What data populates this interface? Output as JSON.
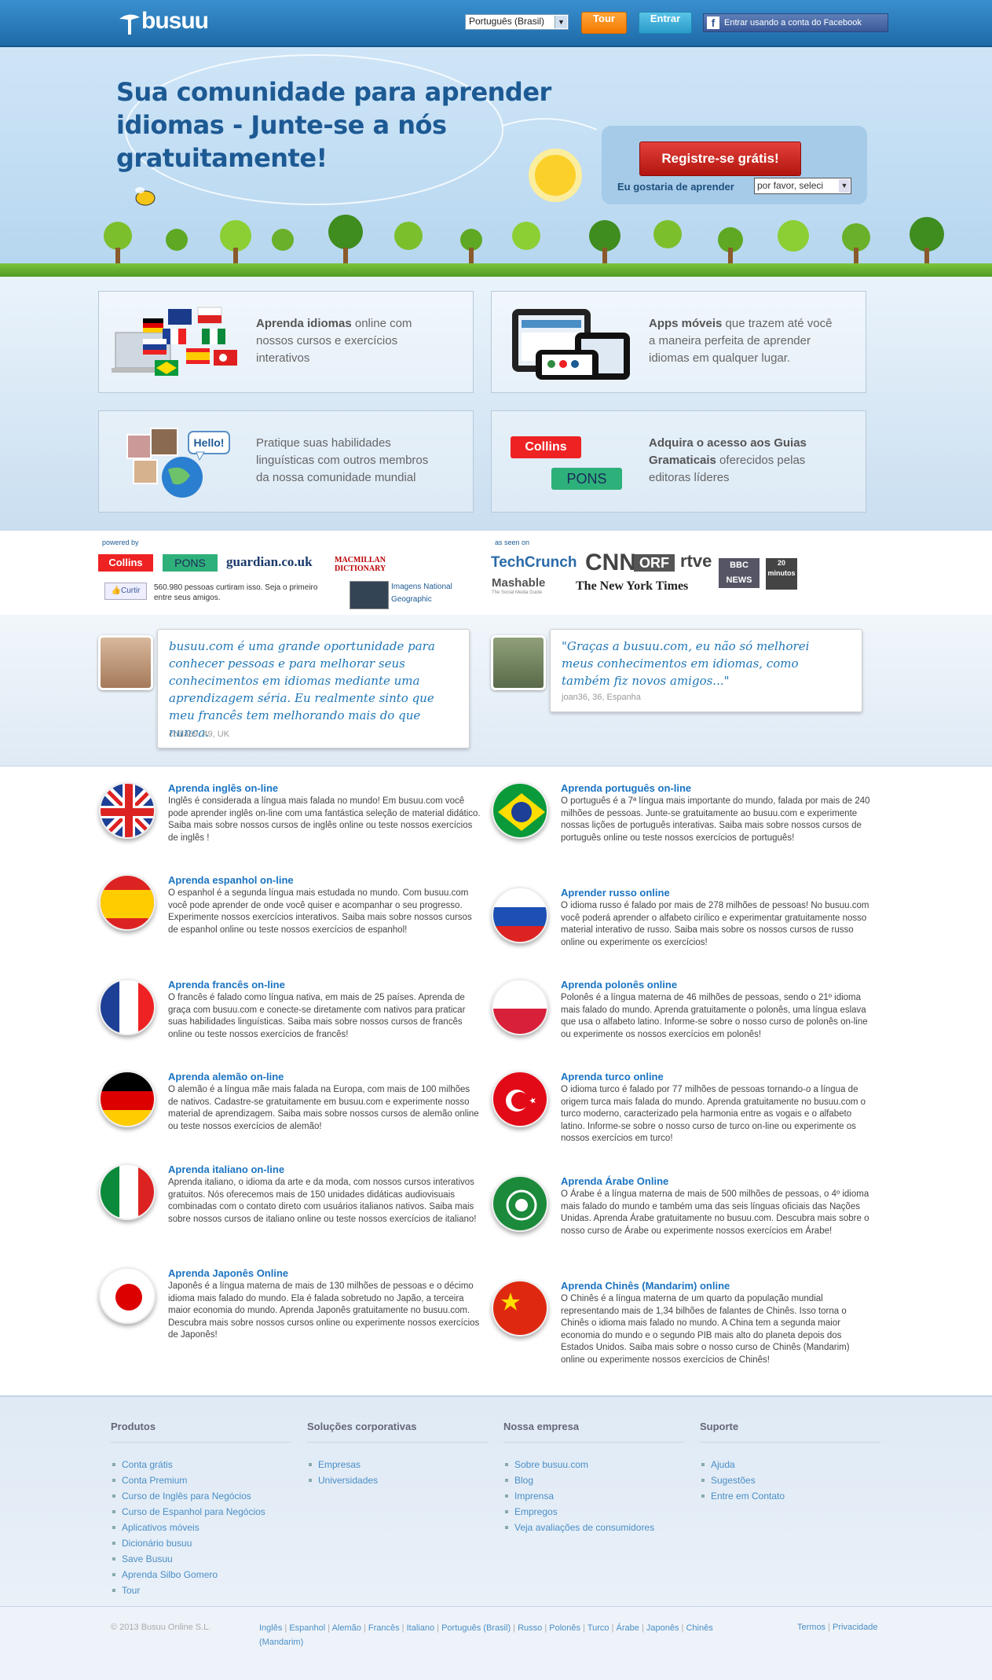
{
  "header": {
    "logo_text": "busuu",
    "language_select": "Português (Brasil)",
    "tour_label": "Tour",
    "login_label": "Entrar",
    "facebook_label": "Entrar usando a conta do Facebook"
  },
  "hero": {
    "title_line1": "Sua comunidade para aprender",
    "title_line2": "idiomas - Junte-se a nós gratuitamente!",
    "register_label": "Registre-se grátis!",
    "learn_label": "Eu gostaria de aprender",
    "learn_select": "por favor, seleci"
  },
  "features": [
    {
      "bold": "Aprenda idiomas",
      "text": " online com nossos cursos e exercícios interativos"
    },
    {
      "bold": "Apps móveis",
      "text": " que trazem até você a maneira perfeita de aprender idiomas em qualquer lugar."
    },
    {
      "bold": "",
      "text": "Pratique suas habilidades linguísticas com outros membros da nossa comunidade mundial",
      "hello": "Hello!"
    },
    {
      "bold": "Adquira o acesso aos Guias Gramaticais",
      "text": " oferecidos pelas editoras líderes",
      "logo1": "Collins",
      "logo2": "PONS"
    }
  ],
  "partners": {
    "powered_label": "powered by",
    "seen_label": "as seen on",
    "powered_logos": [
      "Collins",
      "PONS",
      "guardian.co.uk",
      "MACMILLAN DICTIONARY"
    ],
    "like_label": "Curtir",
    "like_text": "560.980 pessoas curtiram isso. Seja o primeiro entre seus amigos.",
    "natgeo": "Imagens National Geographic",
    "seen_logos": [
      "TechCrunch",
      "CNN",
      "ORF",
      "rtve",
      "BBC NEWS",
      "20 minutos",
      "Mashable",
      "The New York Times"
    ],
    "mashable_sub": "The Social Media Guide"
  },
  "testimonials": [
    {
      "quote": "busuu.com é uma grande oportunidade para conhecer pessoas e para melhorar seus conhecimentos em idiomas mediante uma aprendizagem séria. Eu realmente sinto que meu francês tem melhorando mais do que nunca.",
      "who": "chilla59, 49, UK"
    },
    {
      "quote": "\"Graças a busuu.com, eu não só melhorei meus conhecimentos em idiomas, como também fiz novos amigos...\"",
      "who": "joan36, 36, Espanha"
    }
  ],
  "languages": [
    {
      "title": "Aprenda inglês on-line",
      "text": "Inglês é considerada a língua mais falada no mundo! Em busuu.com você pode aprender inglês on-line com uma fantástica seleção de material didático. Saiba mais sobre nossos cursos de inglês online ou teste nossos exercícios de inglês !",
      "flag": "uk"
    },
    {
      "title": "Aprenda português on-line",
      "text": "O português é a 7ª língua mais importante do mundo, falada por mais de 240 milhões de pessoas. Junte-se gratuitamente ao busuu.com e experimente nossas lições de português interativas. Saiba mais sobre nossos cursos de português online ou teste nossos exercícios de português!",
      "flag": "br"
    },
    {
      "title": "Aprenda espanhol on-line",
      "text": "O espanhol é a segunda língua mais estudada no mundo. Com busuu.com você pode aprender de onde você quiser e acompanhar o seu progresso. Experimente nossos exercícios interativos. Saiba mais sobre nossos cursos de espanhol online ou teste nossos exercícios de espanhol!",
      "flag": "es"
    },
    {
      "title": "Aprender russo online",
      "text": "O idioma russo é falado por mais de 278 milhões de pessoas! No busuu.com você poderá aprender o alfabeto cirílico e experimentar gratuitamente nosso material interativo de russo. Saiba mais sobre os nossos cursos de russo online ou experimente os exercícios!",
      "flag": "ru"
    },
    {
      "title": "Aprenda francês on-line",
      "text": "O francês é falado como língua nativa, em mais de 25 países. Aprenda de graça com busuu.com e conecte-se diretamente com nativos para praticar suas habilidades linguísticas. Saiba mais sobre nossos cursos de francês online ou teste nossos exercícios de francês!",
      "flag": "fr"
    },
    {
      "title": "Aprenda polonês online",
      "text": "Polonês é a língua materna de 46 milhões de pessoas, sendo o 21º idioma mais falado do mundo. Aprenda gratuitamente o polonês, uma língua eslava que usa o alfabeto latino. Informe-se sobre o nosso curso de polonês on-line ou experimente os nossos exercícios em polonês!",
      "flag": "pl"
    },
    {
      "title": "Aprenda alemão on-line",
      "text": "O alemão é a língua mãe mais falada na Europa, com mais de 100 milhões de nativos. Cadastre-se gratuitamente em busuu.com e experimente nosso material de aprendizagem. Saiba mais sobre nossos cursos de alemão online ou teste nossos exercícios de alemão!",
      "flag": "de"
    },
    {
      "title": "Aprenda turco online",
      "text": "O idioma turco é falado por 77 milhões de pessoas tornando-o a língua de origem turca mais falada do mundo. Aprenda gratuitamente no busuu.com o turco moderno, caracterizado pela harmonia entre as vogais e o alfabeto latino. Informe-se sobre o nosso curso de turco on-line ou experimente os nossos exercícios em turco!",
      "flag": "tr"
    },
    {
      "title": "Aprenda italiano on-line",
      "text": "Aprenda italiano, o idioma da arte e da moda, com nossos cursos interativos gratuitos. Nós oferecemos mais de 150 unidades didáticas audiovisuais combinadas com o contato direto com usuários italianos nativos. Saiba mais sobre nossos cursos de italiano online ou teste nossos exercícios de italiano!",
      "flag": "it"
    },
    {
      "title": "Aprenda Árabe Online",
      "text": "O Árabe é a língua materna de mais de 500 milhões de pessoas, o 4º idioma mais falado do mundo e também uma das seis línguas oficiais das Nações Unidas. Aprenda Árabe gratuitamente no busuu.com. Descubra mais sobre o nosso curso de Árabe ou experimente nossos exercícios em Árabe!",
      "flag": "ar"
    },
    {
      "title": "Aprenda Japonês Online",
      "text": "Japonês é a língua materna de mais de 130 milhões de pessoas e o décimo idioma mais falado do mundo. Ela é falada sobretudo no Japão, a terceira maior economia do mundo. Aprenda Japonês gratuitamente no busuu.com. Descubra mais sobre nossos cursos online ou experimente nossos exercícios de Japonês!",
      "flag": "jp"
    },
    {
      "title": "Aprenda Chinês (Mandarim) online",
      "text": "O Chinês é a língua materna de um quarto da população mundial representando mais de 1,34 bilhões de falantes de Chinês. Isso torna o Chinês o idioma mais falado no mundo. A China tem a segunda maior economia do mundo e o segundo PIB mais alto do planeta depois dos Estados Unidos. Saiba mais sobre o nosso curso de Chinês (Mandarim) online ou experimente nossos exercícios de Chinês!",
      "flag": "cn"
    }
  ],
  "footer": {
    "columns": [
      {
        "title": "Produtos",
        "items": [
          "Conta grátis",
          "Conta Premium",
          "Curso de Inglês para Negócios",
          "Curso de Espanhol para Negócios",
          "Aplicativos móveis",
          "Dicionário busuu",
          "Save Busuu",
          "Aprenda Silbo Gomero",
          "Tour"
        ]
      },
      {
        "title": "Soluções corporativas",
        "items": [
          "Empresas",
          "Universidades"
        ]
      },
      {
        "title": "Nossa empresa",
        "items": [
          "Sobre busuu.com",
          "Blog",
          "Imprensa",
          "Empregos",
          "Veja avaliações de consumidores"
        ]
      },
      {
        "title": "Suporte",
        "items": [
          "Ajuda",
          "Sugestões",
          "Entre em Contato"
        ]
      }
    ],
    "copyright": "© 2013 Busuu Online S.L.",
    "language_links": [
      "Inglês",
      "Espanhol",
      "Alemão",
      "Francês",
      "Italiano",
      "Português (Brasil)",
      "Russo",
      "Polonês",
      "Turco",
      "Árabe",
      "Japonês",
      "Chinês (Mandarim)"
    ],
    "terms": "Termos",
    "privacy": "Privacidade"
  },
  "colors": {
    "brand_blue": "#1e6aa8",
    "register_red": "#c0201a",
    "tour_orange": "#f78b10",
    "link_blue": "#1a8fc9"
  }
}
